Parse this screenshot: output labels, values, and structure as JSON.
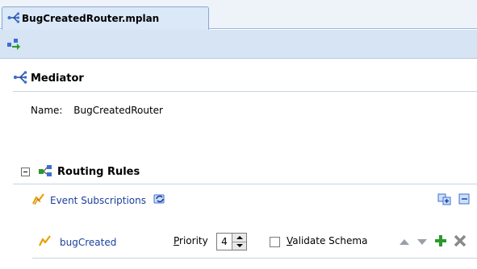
{
  "tab": {
    "title": "BugCreatedRouter.mplan"
  },
  "mediator": {
    "title": "Mediator",
    "name_label": "Name:",
    "name_value": "BugCreatedRouter"
  },
  "routing": {
    "title": "Routing Rules",
    "event_subscriptions_label": "Event Subscriptions",
    "rule": {
      "event_name": "bugCreated",
      "priority_label_u": "P",
      "priority_label_rest": "riority",
      "priority_value": "4",
      "validate_label_u": "V",
      "validate_label_rest": "alidate Schema"
    }
  },
  "colors": {
    "tab_bg": "#dbe8f8",
    "toolbar_bg": "#d6e4f4",
    "link": "#1a3f9e",
    "add_green": "#2a9a2a"
  }
}
